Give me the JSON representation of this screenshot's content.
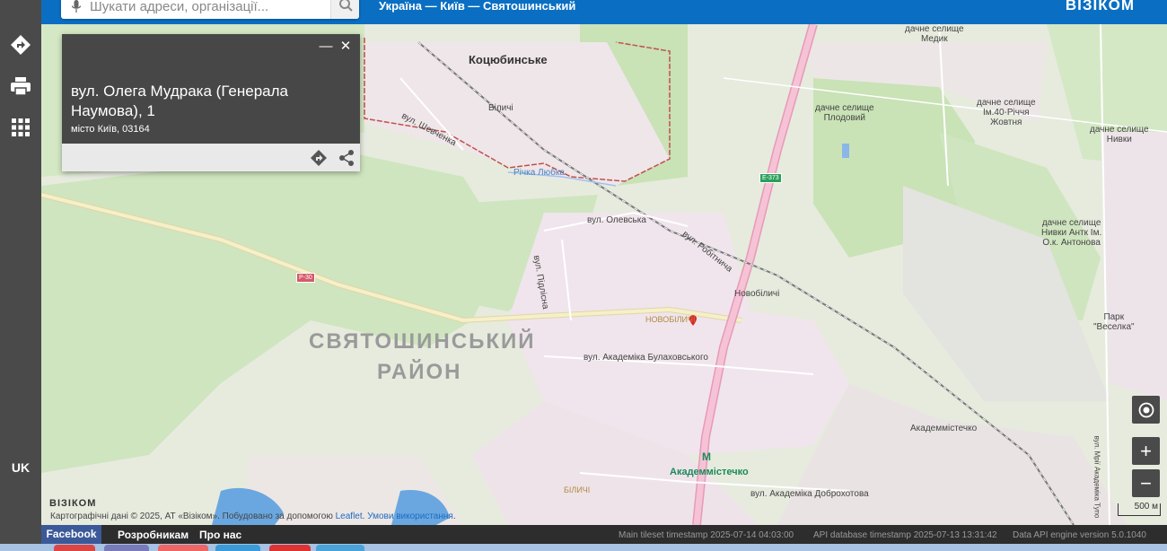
{
  "header": {
    "search_placeholder": "Шукати адреси, організації...",
    "breadcrumb": "Україна — Київ — Святошинський",
    "brand": "ВІЗІКОМ",
    "brand_color": "#0a6fc2"
  },
  "sidebar": {
    "items": [
      {
        "icon": "directions-icon"
      },
      {
        "icon": "print-icon"
      },
      {
        "icon": "apps-grid-icon"
      }
    ],
    "language": "UK"
  },
  "popup": {
    "title": "вул. Олега Мудрака (Генерала Наумова), 1",
    "subtitle": "місто Київ, 03164",
    "minimize": "—",
    "close": "✕"
  },
  "map": {
    "labels": {
      "kotsiubynske": "Коцюбинське",
      "bilychi_n": "Біличі",
      "vul_shevchenka": "вул. Шевченка",
      "richka_liubka": "Річка Любка",
      "vul_olevska": "вул. Олевська",
      "vul_robitnycha": "вул. Робітнича",
      "vul_pidlisna": "вул. Підлісна",
      "novobilychi_station": "Новобіличі",
      "novobilychi_area": "НОВОБІЛИЧІ",
      "district_line1": "СВЯТОШИНСЬКИЙ",
      "district_line2": "РАЙОН",
      "vul_bulakhovskoho": "вул. Академіка Булаховського",
      "akademmistechko_metro": "Академмістечко",
      "bilychi_s": "БІЛИЧІ",
      "vul_dobrokhotova": "вул. Академіка Доброхотова",
      "akademmistechko_rail": "Академмістечко",
      "dachne_medyk": "дачне селище\nМедик",
      "dachne_plodovyi": "дачне селище\nПлодовий",
      "dachne_40": "дачне селище\nІм.40-Річчя\nЖовтня",
      "dachne_nyvky": "дачне селище\nНивки",
      "dachne_antonova": "дачне селище\nНивки Антк Ім.\nО.к. Антонова",
      "park_veselka": "Парк\n\"Веселка\"",
      "vul_mri": "вул. Мрії Академіка Тупо"
    },
    "shields": {
      "e373": "E-373",
      "r30": "Р-30"
    },
    "scale_label": "500 м",
    "logo": "ВІЗІКОМ",
    "attribution_text": "Картографічні дані © 2025, АТ «Візіком». Побудовано за допомогою ",
    "attribution_leaflet": "Leaflet",
    "attribution_terms": "Умови використання",
    "colors": {
      "forest": "#c9e2b6",
      "urban": "#efe4ea",
      "highway": "#f3b9cf",
      "road": "#f6f0c8",
      "water": "#6aa7e0",
      "boundary": "#c0504d"
    }
  },
  "footer": {
    "facebook": "Facebook",
    "developers": "Розробникам",
    "about": "Про нас",
    "tileset": "Main tileset timestamp 2025-07-14 04:03:00",
    "api_db": "API database timestamp 2025-07-13 13:31:42",
    "engine": "Data API engine version 5.0.1040"
  }
}
